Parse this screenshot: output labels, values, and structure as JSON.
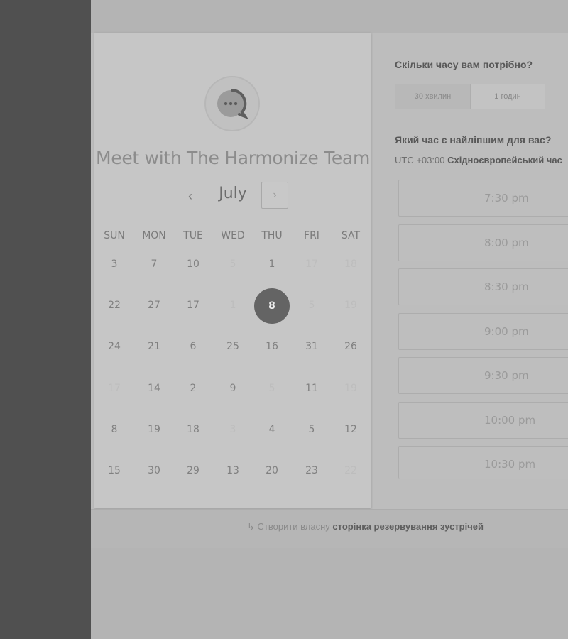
{
  "calendar": {
    "title": "Meet with The Harmonize Team",
    "month": "July",
    "prev_icon": "‹",
    "next_icon": "›",
    "weekdays": [
      "SUN",
      "MON",
      "TUE",
      "WED",
      "THU",
      "FRI",
      "SAT"
    ],
    "weeks": [
      [
        {
          "d": "3",
          "muted": false
        },
        {
          "d": "7",
          "muted": false
        },
        {
          "d": "10",
          "muted": false
        },
        {
          "d": "5",
          "muted": true
        },
        {
          "d": "1",
          "muted": false
        },
        {
          "d": "17",
          "muted": true
        },
        {
          "d": "18",
          "muted": true
        }
      ],
      [
        {
          "d": "22",
          "muted": false
        },
        {
          "d": "27",
          "muted": false
        },
        {
          "d": "17",
          "muted": false
        },
        {
          "d": "1",
          "muted": true
        },
        {
          "d": "8",
          "muted": false,
          "selected": true
        },
        {
          "d": "5",
          "muted": true
        },
        {
          "d": "19",
          "muted": true
        }
      ],
      [
        {
          "d": "24",
          "muted": false
        },
        {
          "d": "21",
          "muted": false
        },
        {
          "d": "6",
          "muted": false
        },
        {
          "d": "25",
          "muted": false
        },
        {
          "d": "16",
          "muted": false
        },
        {
          "d": "31",
          "muted": false
        },
        {
          "d": "26",
          "muted": false
        }
      ],
      [
        {
          "d": "17",
          "muted": true
        },
        {
          "d": "14",
          "muted": false
        },
        {
          "d": "2",
          "muted": false
        },
        {
          "d": "9",
          "muted": false
        },
        {
          "d": "5",
          "muted": true
        },
        {
          "d": "11",
          "muted": false
        },
        {
          "d": "19",
          "muted": true
        }
      ],
      [
        {
          "d": "8",
          "muted": false
        },
        {
          "d": "19",
          "muted": false
        },
        {
          "d": "18",
          "muted": false
        },
        {
          "d": "3",
          "muted": true
        },
        {
          "d": "4",
          "muted": false
        },
        {
          "d": "5",
          "muted": false
        },
        {
          "d": "12",
          "muted": false
        }
      ],
      [
        {
          "d": "15",
          "muted": false
        },
        {
          "d": "30",
          "muted": false
        },
        {
          "d": "29",
          "muted": false
        },
        {
          "d": "13",
          "muted": false
        },
        {
          "d": "20",
          "muted": false
        },
        {
          "d": "23",
          "muted": false
        },
        {
          "d": "22",
          "muted": true
        }
      ]
    ]
  },
  "duration": {
    "question": "Скільки часу вам потрібно?",
    "options": [
      "30 хвилин",
      "1 годин"
    ]
  },
  "time": {
    "question": "Який час є найліпшим для вас?",
    "tz_prefix": "UTC +03:00",
    "tz_name": "Східноєвропейський час",
    "slots": [
      "7:30 pm",
      "8:00 pm",
      "8:30 pm",
      "9:00 pm",
      "9:30 pm",
      "10:00 pm",
      "10:30 pm"
    ]
  },
  "footer": {
    "icon": "↳",
    "prefix": "Створити власну",
    "link": "сторінка резервування зустрічей"
  },
  "colors": {
    "selected_day": "#646464",
    "sidebar": "#505050"
  }
}
